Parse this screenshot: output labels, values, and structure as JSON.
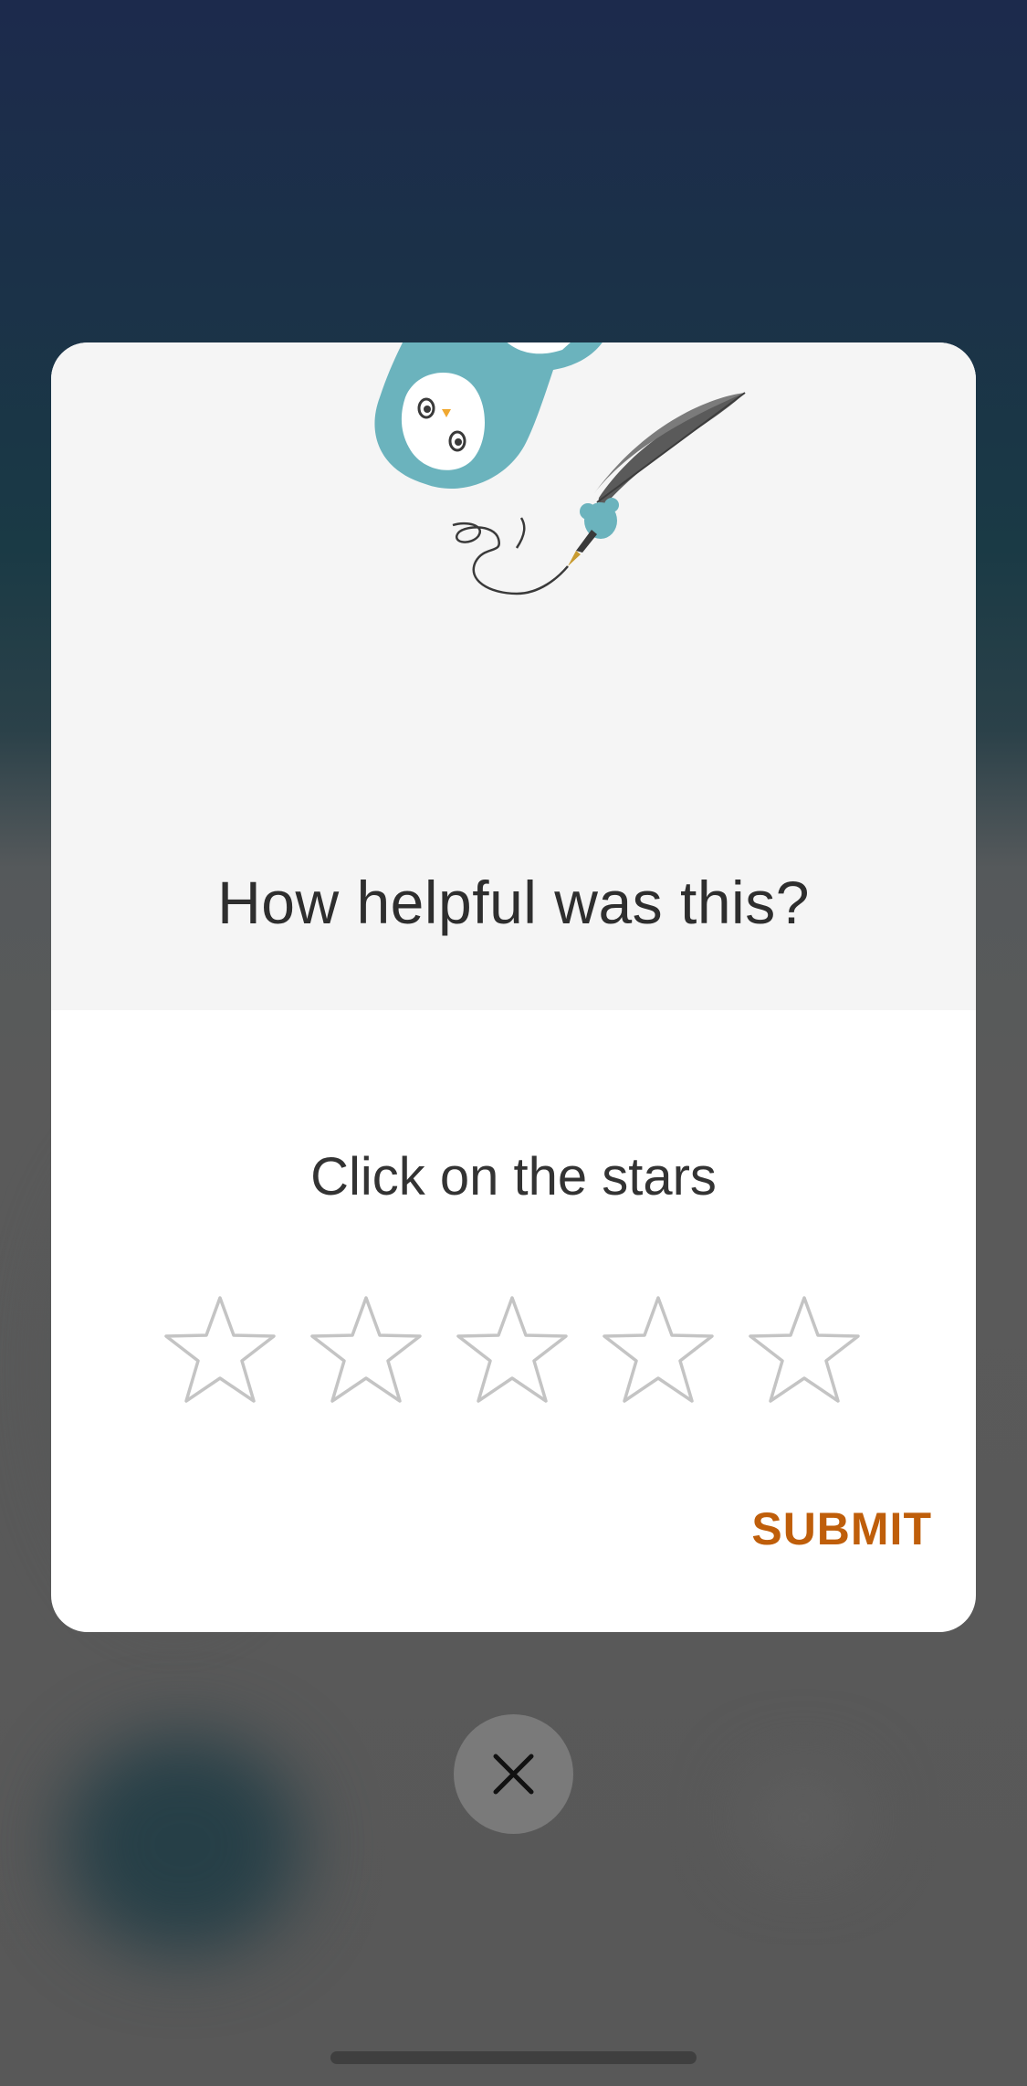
{
  "dialog": {
    "title": "How helpful was this?",
    "instruction": "Click on the stars",
    "rating": {
      "max": 5,
      "selected": 0
    },
    "submit_label": "SUBMIT"
  },
  "colors": {
    "accent": "#bf5e0a",
    "star_outline": "#c4c4c4",
    "mascot": "#6bb3bd"
  },
  "icons": {
    "close": "close-icon",
    "star": "star-outline-icon",
    "mascot": "owl-writer-illustration"
  }
}
